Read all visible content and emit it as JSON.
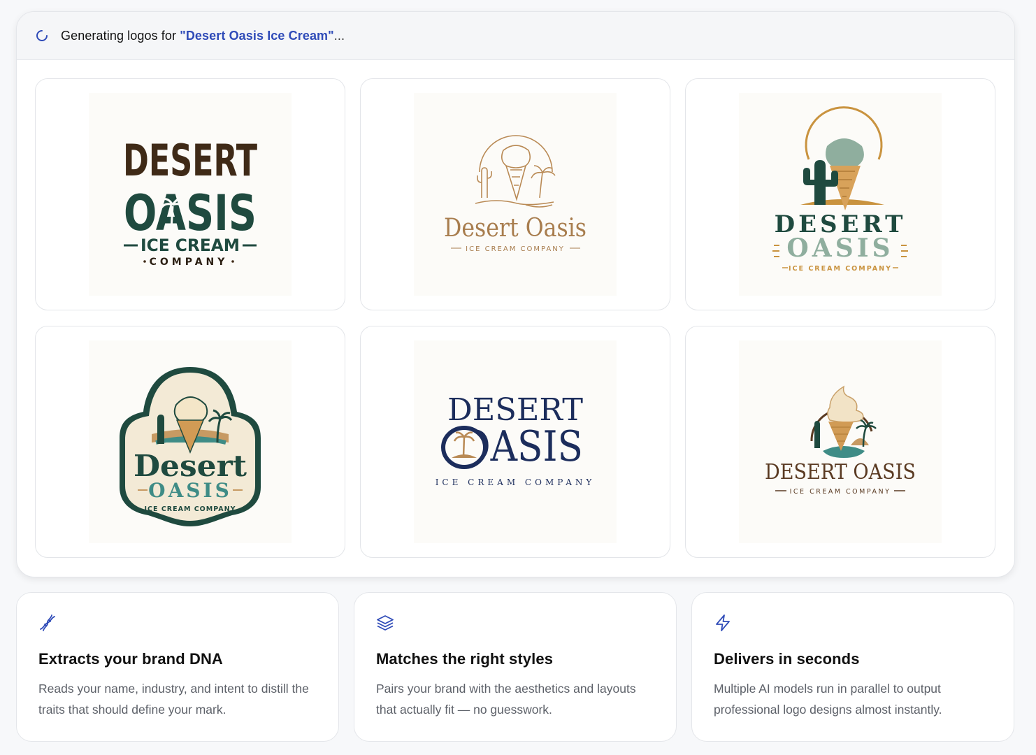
{
  "header": {
    "prefix": "Generating logos for ",
    "brand": "\"Desert Oasis Ice Cream\"",
    "suffix": "..."
  },
  "logos": [
    {
      "line1": "DESERT",
      "line2": "OASIS",
      "line3": "ICE CREAM",
      "line4": "COMPANY"
    },
    {
      "line1": "Desert Oasis",
      "line2": "ICE CREAM COMPANY"
    },
    {
      "line1": "DESERT",
      "line2": "OASIS",
      "line3": "ICE CREAM COMPANY"
    },
    {
      "line1": "Desert",
      "line2": "OASIS",
      "line3": "ICE CREAM COMPANY"
    },
    {
      "line1": "DESERT",
      "line2": "OASIS",
      "line3": "ICE CREAM COMPANY"
    },
    {
      "line1": "DESERT OASIS",
      "line2": "ICE CREAM COMPANY"
    }
  ],
  "features": [
    {
      "icon": "dna-icon",
      "title": "Extracts your brand DNA",
      "desc": "Reads your name, industry, and intent to distill the traits that should define your mark."
    },
    {
      "icon": "layers-icon",
      "title": "Matches the right styles",
      "desc": "Pairs your brand with the aesthetics and layouts that actually fit — no guesswork."
    },
    {
      "icon": "lightning-icon",
      "title": "Delivers in seconds",
      "desc": "Multiple AI models run in parallel to output professional logo designs almost instantly."
    }
  ],
  "colors": {
    "accent": "#2f4bb8",
    "logo_brown": "#3f2a17",
    "logo_green": "#1f4a3f",
    "logo_tan": "#b98a55",
    "logo_navy": "#1c2d5c"
  }
}
